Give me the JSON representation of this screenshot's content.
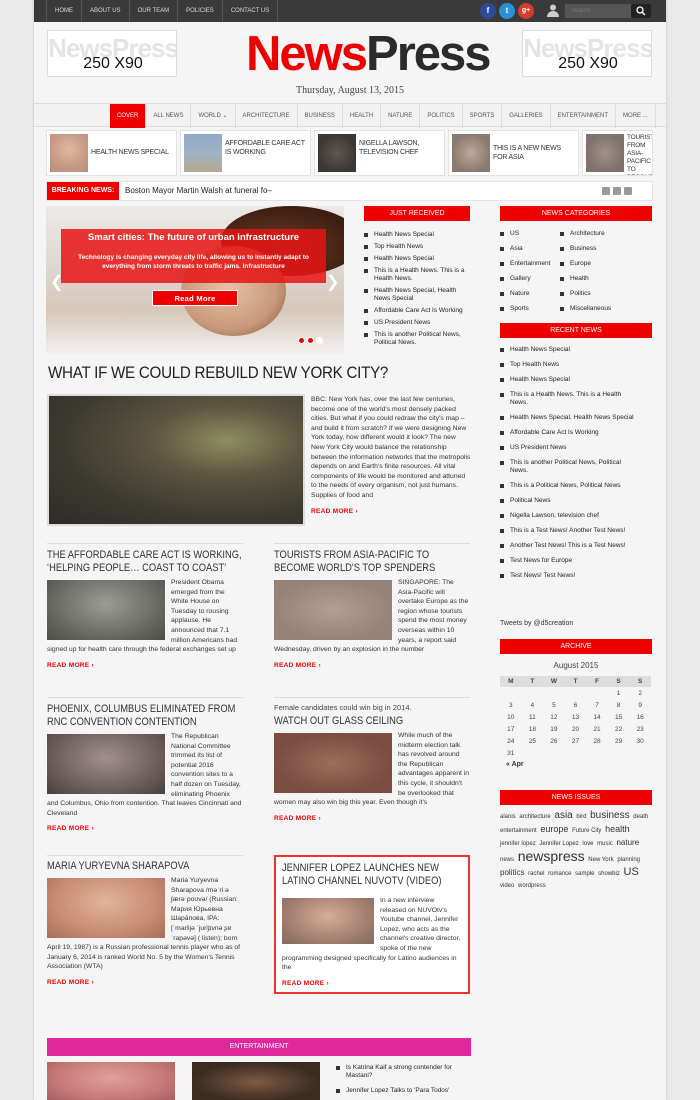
{
  "topnav": [
    "HOME",
    "ABOUT US",
    "OUR TEAM",
    "POLICIES",
    "CONTACT US"
  ],
  "social": [
    "f",
    "t",
    "g+"
  ],
  "search": {
    "placeholder": "Search..."
  },
  "ads": {
    "ghost": "NewsPress",
    "size": "250 X90"
  },
  "logo": {
    "news": "News",
    "press": "Press"
  },
  "date": "Thursday, August 13, 2015",
  "mainnav": [
    "COVER",
    "ALL NEWS",
    "WORLD ⌄",
    "ARCHITECTURE",
    "BUSINESS",
    "HEALTH",
    "NATURE",
    "POLITICS",
    "SPORTS",
    "GALLERIES",
    "ENTERTAINMENT",
    "MORE ..."
  ],
  "strip": [
    "HEALTH NEWS SPECIAL",
    "AFFORDABLE CARE ACT IS WORKING",
    "NIGELLA LAWSON, TELEVISION CHEF",
    "THIS IS A NEW NEWS FOR ASIA",
    "TOURISTS FROM ASIA-PACIFIC TO BECOME WORLD'S TOP SPENDERS"
  ],
  "breaking": {
    "label": "BREAKING NEWS:",
    "text": "Boston Mayor Martin Walsh at funeral fo–"
  },
  "slider": {
    "title": "Smart cities: The future of urban infrastructure",
    "desc": "Technology is changing everyday city life, allowing us to instantly adapt to everything from storm threats to traffic jams. Infrastructure",
    "more": "Read More"
  },
  "just_received": {
    "title": "JUST RECEIVED",
    "items": [
      "Health News Special",
      "Top Health News",
      "Health News Special",
      "This is a Health News. This is a Health News.",
      "Health News Special, Health News Special",
      "Affordable Care Act Is Working",
      "US President News",
      "This is another Political News, Political News."
    ]
  },
  "categories": {
    "title": "NEWS CATEGORIES",
    "left": [
      "US",
      "Asia",
      "Entertainment",
      "Gallery",
      "Nature",
      "Sports"
    ],
    "right": [
      "Architecture",
      "Business",
      "Europe",
      "Health",
      "Politics",
      "Miscellaneous"
    ]
  },
  "recent": {
    "title": "RECENT NEWS",
    "items": [
      "Health News Special",
      "Top Health News",
      "Health News Special",
      "This is a Health News. This is a Health News.",
      "Health News Special, Health News Special",
      "Affordable Care Act Is Working",
      "US President News",
      "This is another Political News, Political News.",
      "This is a Political News, Political News",
      "Political News",
      "Nigella Lawson, television chef",
      "This is a Test News! Another Test News!",
      "Another Test News! This is a Test News!",
      "Test News for Europe",
      "Test News! Test News!"
    ]
  },
  "tweets": "Tweets by @d5creation",
  "archive": {
    "title": "ARCHIVE",
    "month": "August 2015",
    "days": [
      "M",
      "T",
      "W",
      "T",
      "F",
      "S",
      "S"
    ],
    "rows": [
      [
        "",
        "",
        "",
        "",
        "",
        "1",
        "2"
      ],
      [
        "3",
        "4",
        "5",
        "6",
        "7",
        "8",
        "9"
      ],
      [
        "10",
        "11",
        "12",
        "13",
        "14",
        "15",
        "16"
      ],
      [
        "17",
        "18",
        "19",
        "20",
        "21",
        "22",
        "23"
      ],
      [
        "24",
        "25",
        "26",
        "27",
        "28",
        "29",
        "30"
      ],
      [
        "31",
        "",
        "",
        "",
        "",
        "",
        ""
      ]
    ],
    "prev": "« Apr"
  },
  "issues": {
    "title": "NEWS ISSUES"
  },
  "featured": {
    "title": "WHAT IF WE COULD REBUILD NEW YORK CITY?",
    "body": "BBC: New York has, over the last few centuries, become one of the world's most densely packed cities. But what if you could redraw the city's map – and build it from scratch? If we were designing New York today, how different would it look? The new New York City would balance the relationship between the information networks that the metropolis depends on and Earth's finite resources. All vital components of life would be monitored and attuned to the needs of every organism, not just humans. Supplies of food and",
    "more": "READ MORE ›"
  },
  "articles": [
    {
      "title": "THE AFFORDABLE CARE ACT IS WORKING, ‘HELPING PEOPLE… COAST TO COAST’",
      "body": "President Obama emerged from the White House on Tuesday to rousing applause. He announced that 7.1 million Americans had signed up for health care through the federal exchanges set up",
      "more": "READ MORE ›"
    },
    {
      "title": "TOURISTS FROM ASIA-PACIFIC TO BECOME WORLD'S TOP SPENDERS",
      "body": "SINGAPORE: The Asia-Pacific will overtake Europe as the region whose tourists spend the most money overseas within 10 years, a report said Wednesday, driven by an explosion in the number",
      "more": "READ MORE ›"
    },
    {
      "title": "PHOENIX, COLUMBUS ELIMINATED FROM RNC CONVENTION CONTENTION",
      "body": "The Republican National Committee trimmed its list of potential 2016 convention sites to a half dozen on Tuesday, eliminating Phoenix and Columbus, Ohio from contention. That leaves Cincinnati and Cleveland",
      "more": "READ MORE ›"
    },
    {
      "kicker": "Female candidates could win big in 2014.",
      "title": "WATCH OUT GLASS CEILING",
      "body": "While much of the midterm election talk has revolved around the Republican advantages apparent in this cycle, it shouldn't be overlooked that women may also win big this year. Even though it's",
      "more": "READ MORE ›"
    },
    {
      "title": "MARIA YURYEVNA SHARAPOVA",
      "body": "Maria Yuryevna Sharapova /məˈriːə ʃærəˈpoʊvə/ (Russian: Мария Юрьевна Шара́пова, IPA: [ˈmarʲijə ˈjurʲjɪvnə ʂɐˈrapəvə] ( listen); born April 19, 1987) is a Russian professional tennis player who as of January 6, 2014 is ranked World No. 5 by the Women's Tennis Association (WTA)",
      "more": "READ MORE ›"
    },
    {
      "title": "JENNIFER LOPEZ LAUNCHES NEW LATINO CHANNEL NUVOTV (VIDEO)",
      "body": "In a new interview released on NUVOtv's Youtube channel, Jennifer Lopez, who acts as the channel's creative director, spoke of the new programming designed specifically for Latino audiences in the",
      "more": "READ MORE ›"
    }
  ],
  "entertainment": {
    "title": "ENTERTAINMENT",
    "items": [
      "Is Katrina Kaif a strong contender for Mastani?",
      "Jennifer Lopez Talks to 'Para Todos'"
    ]
  }
}
